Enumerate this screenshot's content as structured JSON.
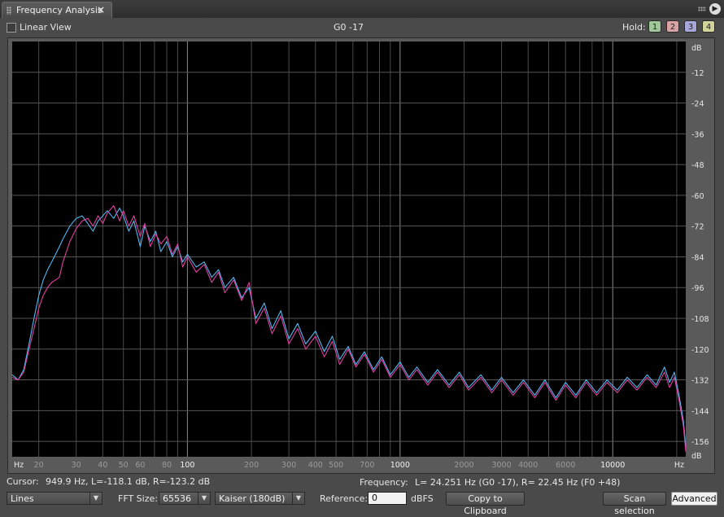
{
  "tab": {
    "title": "Frequency Analysis",
    "close": "×",
    "menu": "▶"
  },
  "toolbar": {
    "linear_view_label": "Linear View",
    "linear_view_checked": false,
    "center_label": "G0 -17",
    "hold_label": "Hold:",
    "hold_buttons": [
      {
        "label": "1",
        "color": "#9fc79a"
      },
      {
        "label": "2",
        "color": "#d9a3a3"
      },
      {
        "label": "3",
        "color": "#a7a7d9"
      },
      {
        "label": "4",
        "color": "#d4d49a"
      }
    ]
  },
  "chart_data": {
    "type": "line",
    "x_scale": "log",
    "xlim": [
      15,
      22050
    ],
    "ylim": [
      -162,
      0
    ],
    "y_unit_top": "dB",
    "y_unit_bottom": "dB",
    "x_unit_left": "Hz",
    "x_unit_right": "Hz",
    "y_ticks": [
      "-12",
      "-24",
      "-36",
      "-48",
      "-60",
      "-72",
      "-84",
      "-96",
      "-108",
      "-120",
      "-132",
      "-144",
      "-156"
    ],
    "x_tick_labels": [
      {
        "f": 20,
        "label": "20"
      },
      {
        "f": 30,
        "label": "30"
      },
      {
        "f": 40,
        "label": "40"
      },
      {
        "f": 50,
        "label": "50"
      },
      {
        "f": 60,
        "label": "60"
      },
      {
        "f": 80,
        "label": "80"
      },
      {
        "f": 100,
        "label": "100"
      },
      {
        "f": 200,
        "label": "200"
      },
      {
        "f": 300,
        "label": "300"
      },
      {
        "f": 400,
        "label": "400"
      },
      {
        "f": 500,
        "label": "500"
      },
      {
        "f": 700,
        "label": "700"
      },
      {
        "f": 1000,
        "label": "1000"
      },
      {
        "f": 2000,
        "label": "2000"
      },
      {
        "f": 3000,
        "label": "3000"
      },
      {
        "f": 4000,
        "label": "4000"
      },
      {
        "f": 6000,
        "label": "6000"
      },
      {
        "f": 10000,
        "label": "10000"
      }
    ],
    "grid": true,
    "background": "#000000",
    "series": [
      {
        "color": "#4fb8f0",
        "points": [
          [
            15,
            -130
          ],
          [
            16,
            -132
          ],
          [
            17,
            -128
          ],
          [
            18,
            -118
          ],
          [
            19,
            -108
          ],
          [
            20,
            -99
          ],
          [
            21,
            -93
          ],
          [
            22,
            -89
          ],
          [
            23,
            -86
          ],
          [
            24,
            -83
          ],
          [
            25,
            -80
          ],
          [
            26,
            -77
          ],
          [
            28,
            -72
          ],
          [
            30,
            -69
          ],
          [
            32,
            -68
          ],
          [
            34,
            -71
          ],
          [
            36,
            -74
          ],
          [
            38,
            -70
          ],
          [
            40,
            -68
          ],
          [
            42,
            -66
          ],
          [
            45,
            -69
          ],
          [
            48,
            -65
          ],
          [
            50,
            -68
          ],
          [
            53,
            -74
          ],
          [
            56,
            -70
          ],
          [
            60,
            -80
          ],
          [
            63,
            -72
          ],
          [
            67,
            -78
          ],
          [
            71,
            -74
          ],
          [
            75,
            -82
          ],
          [
            80,
            -78
          ],
          [
            85,
            -84
          ],
          [
            90,
            -80
          ],
          [
            95,
            -86
          ],
          [
            100,
            -83
          ],
          [
            110,
            -88
          ],
          [
            120,
            -86
          ],
          [
            130,
            -92
          ],
          [
            140,
            -89
          ],
          [
            150,
            -96
          ],
          [
            165,
            -92
          ],
          [
            180,
            -100
          ],
          [
            195,
            -96
          ],
          [
            210,
            -108
          ],
          [
            230,
            -102
          ],
          [
            250,
            -112
          ],
          [
            275,
            -105
          ],
          [
            300,
            -116
          ],
          [
            330,
            -110
          ],
          [
            360,
            -118
          ],
          [
            400,
            -113
          ],
          [
            440,
            -121
          ],
          [
            480,
            -115
          ],
          [
            520,
            -124
          ],
          [
            570,
            -119
          ],
          [
            620,
            -126
          ],
          [
            680,
            -121
          ],
          [
            750,
            -128
          ],
          [
            820,
            -123
          ],
          [
            900,
            -130
          ],
          [
            1000,
            -125
          ],
          [
            1100,
            -131
          ],
          [
            1200,
            -127
          ],
          [
            1350,
            -133
          ],
          [
            1500,
            -128
          ],
          [
            1700,
            -134
          ],
          [
            1900,
            -129
          ],
          [
            2100,
            -135
          ],
          [
            2400,
            -130
          ],
          [
            2700,
            -136
          ],
          [
            3000,
            -131
          ],
          [
            3400,
            -137
          ],
          [
            3800,
            -132
          ],
          [
            4300,
            -138
          ],
          [
            4800,
            -132
          ],
          [
            5400,
            -139
          ],
          [
            6000,
            -133
          ],
          [
            6700,
            -138
          ],
          [
            7500,
            -132
          ],
          [
            8400,
            -137
          ],
          [
            9400,
            -132
          ],
          [
            10500,
            -136
          ],
          [
            11700,
            -131
          ],
          [
            13000,
            -135
          ],
          [
            14500,
            -130
          ],
          [
            16000,
            -134
          ],
          [
            17500,
            -127
          ],
          [
            18500,
            -133
          ],
          [
            19500,
            -129
          ],
          [
            20500,
            -138
          ],
          [
            21500,
            -148
          ],
          [
            22050,
            -158
          ]
        ]
      },
      {
        "color": "#e040a0",
        "points": [
          [
            15,
            -131
          ],
          [
            16,
            -132
          ],
          [
            17,
            -129
          ],
          [
            18,
            -120
          ],
          [
            19,
            -112
          ],
          [
            20,
            -104
          ],
          [
            21,
            -99
          ],
          [
            22,
            -96
          ],
          [
            23,
            -94
          ],
          [
            24,
            -93
          ],
          [
            25,
            -92
          ],
          [
            26,
            -86
          ],
          [
            28,
            -78
          ],
          [
            30,
            -73
          ],
          [
            32,
            -70
          ],
          [
            34,
            -69
          ],
          [
            36,
            -72
          ],
          [
            38,
            -68
          ],
          [
            40,
            -71
          ],
          [
            42,
            -67
          ],
          [
            45,
            -64
          ],
          [
            48,
            -70
          ],
          [
            50,
            -66
          ],
          [
            53,
            -72
          ],
          [
            56,
            -68
          ],
          [
            60,
            -76
          ],
          [
            63,
            -71
          ],
          [
            67,
            -80
          ],
          [
            71,
            -75
          ],
          [
            75,
            -79
          ],
          [
            80,
            -76
          ],
          [
            85,
            -83
          ],
          [
            90,
            -79
          ],
          [
            95,
            -88
          ],
          [
            100,
            -84
          ],
          [
            110,
            -90
          ],
          [
            120,
            -87
          ],
          [
            130,
            -94
          ],
          [
            140,
            -90
          ],
          [
            150,
            -98
          ],
          [
            165,
            -93
          ],
          [
            180,
            -101
          ],
          [
            195,
            -94
          ],
          [
            210,
            -110
          ],
          [
            230,
            -104
          ],
          [
            250,
            -114
          ],
          [
            275,
            -107
          ],
          [
            300,
            -118
          ],
          [
            330,
            -112
          ],
          [
            360,
            -120
          ],
          [
            400,
            -115
          ],
          [
            440,
            -123
          ],
          [
            480,
            -117
          ],
          [
            520,
            -126
          ],
          [
            570,
            -120
          ],
          [
            620,
            -127
          ],
          [
            680,
            -122
          ],
          [
            750,
            -129
          ],
          [
            820,
            -124
          ],
          [
            900,
            -131
          ],
          [
            1000,
            -126
          ],
          [
            1100,
            -132
          ],
          [
            1200,
            -128
          ],
          [
            1350,
            -134
          ],
          [
            1500,
            -129
          ],
          [
            1700,
            -135
          ],
          [
            1900,
            -130
          ],
          [
            2100,
            -136
          ],
          [
            2400,
            -131
          ],
          [
            2700,
            -137
          ],
          [
            3000,
            -132
          ],
          [
            3400,
            -138
          ],
          [
            3800,
            -133
          ],
          [
            4300,
            -139
          ],
          [
            4800,
            -133
          ],
          [
            5400,
            -140
          ],
          [
            6000,
            -134
          ],
          [
            6700,
            -139
          ],
          [
            7500,
            -133
          ],
          [
            8400,
            -138
          ],
          [
            9400,
            -133
          ],
          [
            10500,
            -137
          ],
          [
            11700,
            -132
          ],
          [
            13000,
            -136
          ],
          [
            14500,
            -131
          ],
          [
            16000,
            -135
          ],
          [
            17500,
            -129
          ],
          [
            18500,
            -135
          ],
          [
            19500,
            -131
          ],
          [
            20500,
            -140
          ],
          [
            21500,
            -150
          ],
          [
            22050,
            -160
          ]
        ]
      }
    ]
  },
  "status": {
    "cursor_label": "Cursor:",
    "cursor_value": "949.9 Hz, L=-118.1 dB, R=-123.2 dB",
    "frequency_label": "Frequency:",
    "frequency_value": "L= 24.251 Hz (G0 -17), R=  22.45 Hz (F0 +48)"
  },
  "controls": {
    "display_mode": "Lines",
    "fft_label": "FFT Size:",
    "fft_size": "65536",
    "window": "Kaiser (180dB)",
    "reference_label": "Reference:",
    "reference_value": "0",
    "reference_unit": "dBFS",
    "copy_button": "Copy to Clipboard",
    "scan_button": "Scan selection",
    "advanced_button": "Advanced"
  }
}
